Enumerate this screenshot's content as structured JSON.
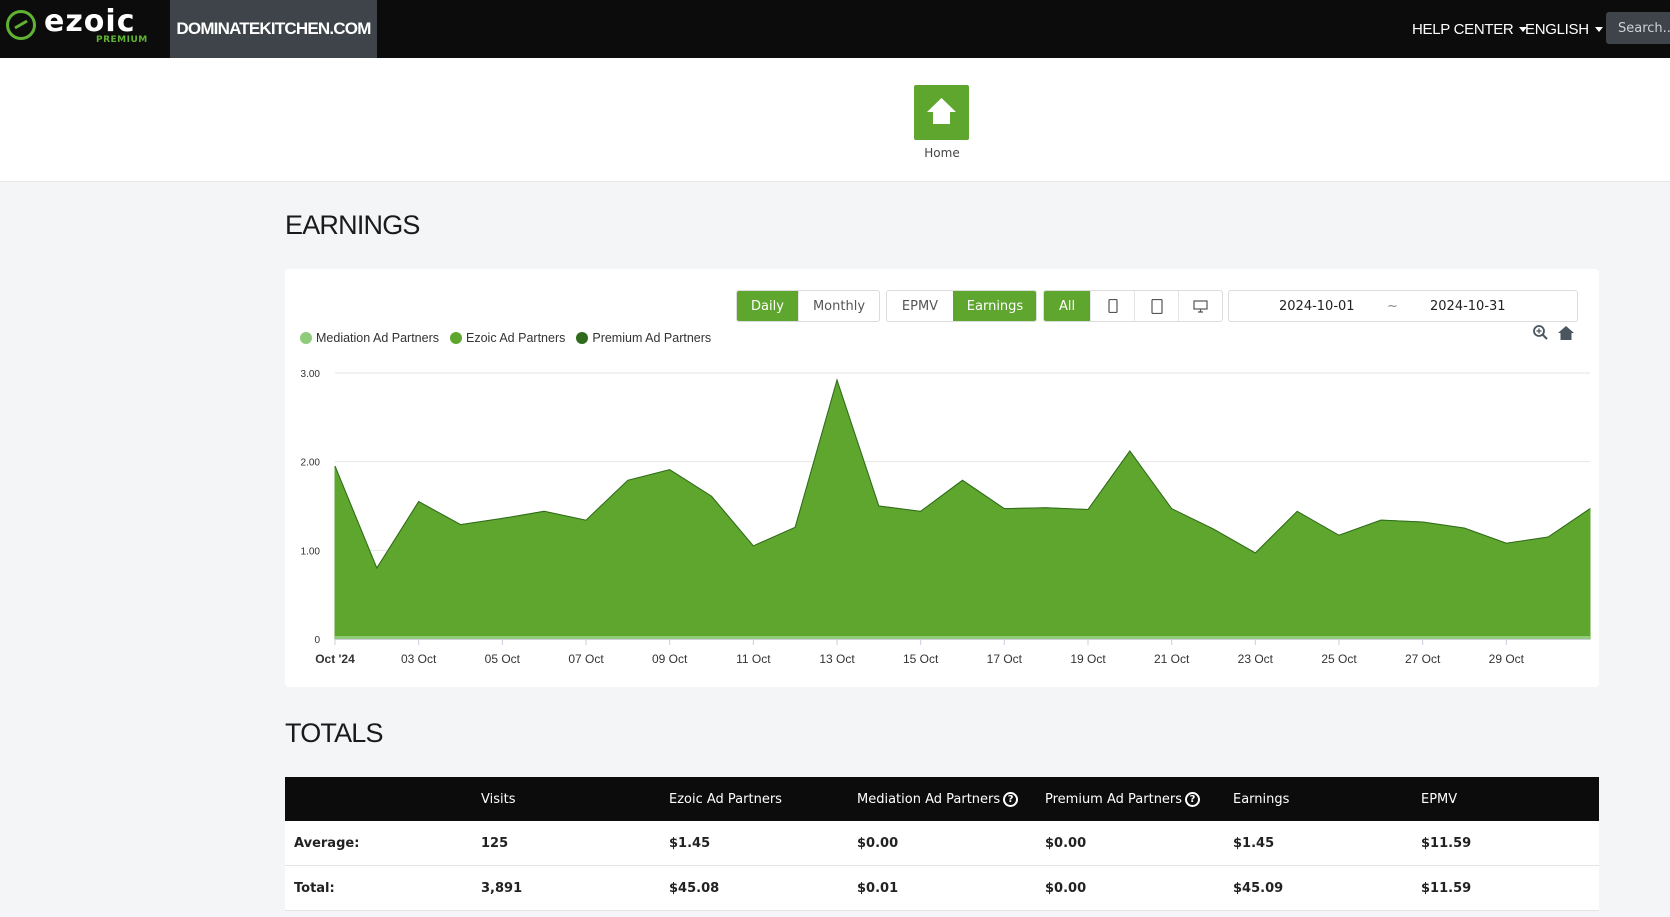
{
  "header": {
    "logo_text": "ezoic",
    "logo_sub": "PREMIUM",
    "site_name": "DOMINATEKITCHEN.COM",
    "help_center": "HELP CENTER",
    "language": "ENGLISH",
    "search_placeholder": "Search..."
  },
  "home": {
    "label": "Home"
  },
  "earnings": {
    "title": "EARNINGS",
    "period_buttons": [
      "Daily",
      "Monthly"
    ],
    "metric_buttons": [
      "EPMV",
      "Earnings"
    ],
    "device_all": "All",
    "date_start": "2024-10-01",
    "date_sep": "~",
    "date_end": "2024-10-31",
    "accent_color": "#5ea62e"
  },
  "chart_data": {
    "type": "area",
    "title": "",
    "xlabel": "",
    "ylabel": "",
    "ylim": [
      0,
      3
    ],
    "yticks": [
      0,
      1,
      2,
      3
    ],
    "ytick_labels": [
      "0",
      "1.00",
      "2.00",
      "3.00"
    ],
    "x_tick_labels": [
      "Oct '24",
      "03 Oct",
      "05 Oct",
      "07 Oct",
      "09 Oct",
      "11 Oct",
      "13 Oct",
      "15 Oct",
      "17 Oct",
      "19 Oct",
      "21 Oct",
      "23 Oct",
      "25 Oct",
      "27 Oct",
      "29 Oct"
    ],
    "x": [
      "2024-10-01",
      "2024-10-02",
      "2024-10-03",
      "2024-10-04",
      "2024-10-05",
      "2024-10-06",
      "2024-10-07",
      "2024-10-08",
      "2024-10-09",
      "2024-10-10",
      "2024-10-11",
      "2024-10-12",
      "2024-10-13",
      "2024-10-14",
      "2024-10-15",
      "2024-10-16",
      "2024-10-17",
      "2024-10-18",
      "2024-10-19",
      "2024-10-20",
      "2024-10-21",
      "2024-10-22",
      "2024-10-23",
      "2024-10-24",
      "2024-10-25",
      "2024-10-26",
      "2024-10-27",
      "2024-10-28",
      "2024-10-29",
      "2024-10-30",
      "2024-10-31"
    ],
    "legend_position": "top-left",
    "grid": true,
    "series": [
      {
        "name": "Mediation Ad Partners",
        "color": "#8fcc7a",
        "values": [
          0,
          0,
          0,
          0,
          0,
          0,
          0,
          0,
          0,
          0,
          0,
          0,
          0,
          0,
          0,
          0,
          0.01,
          0,
          0,
          0,
          0,
          0,
          0,
          0,
          0,
          0,
          0,
          0,
          0,
          0,
          0
        ]
      },
      {
        "name": "Ezoic Ad Partners",
        "color": "#5ea62e",
        "values": [
          1.95,
          0.8,
          1.55,
          1.29,
          1.36,
          1.44,
          1.34,
          1.79,
          1.91,
          1.61,
          1.05,
          1.26,
          2.92,
          1.5,
          1.44,
          1.79,
          1.46,
          1.48,
          1.46,
          2.12,
          1.47,
          1.24,
          0.97,
          1.44,
          1.17,
          1.34,
          1.32,
          1.25,
          1.08,
          1.15,
          1.47
        ]
      },
      {
        "name": "Premium Ad Partners",
        "color": "#2f6b1c",
        "values": [
          0,
          0,
          0,
          0,
          0,
          0,
          0,
          0,
          0,
          0,
          0,
          0,
          0,
          0,
          0,
          0,
          0,
          0,
          0,
          0,
          0,
          0,
          0,
          0,
          0,
          0,
          0,
          0,
          0,
          0,
          0
        ]
      }
    ]
  },
  "totals": {
    "title": "TOTALS",
    "headers": [
      "",
      "Visits",
      "Ezoic Ad Partners",
      "Mediation Ad Partners",
      "Premium Ad Partners",
      "Earnings",
      "EPMV"
    ],
    "help_glyph": "?",
    "rows": [
      [
        "Average:",
        "125",
        "$1.45",
        "$0.00",
        "$0.00",
        "$1.45",
        "$11.59"
      ],
      [
        "Total:",
        "3,891",
        "$45.08",
        "$0.01",
        "$0.00",
        "$45.09",
        "$11.59"
      ]
    ]
  }
}
